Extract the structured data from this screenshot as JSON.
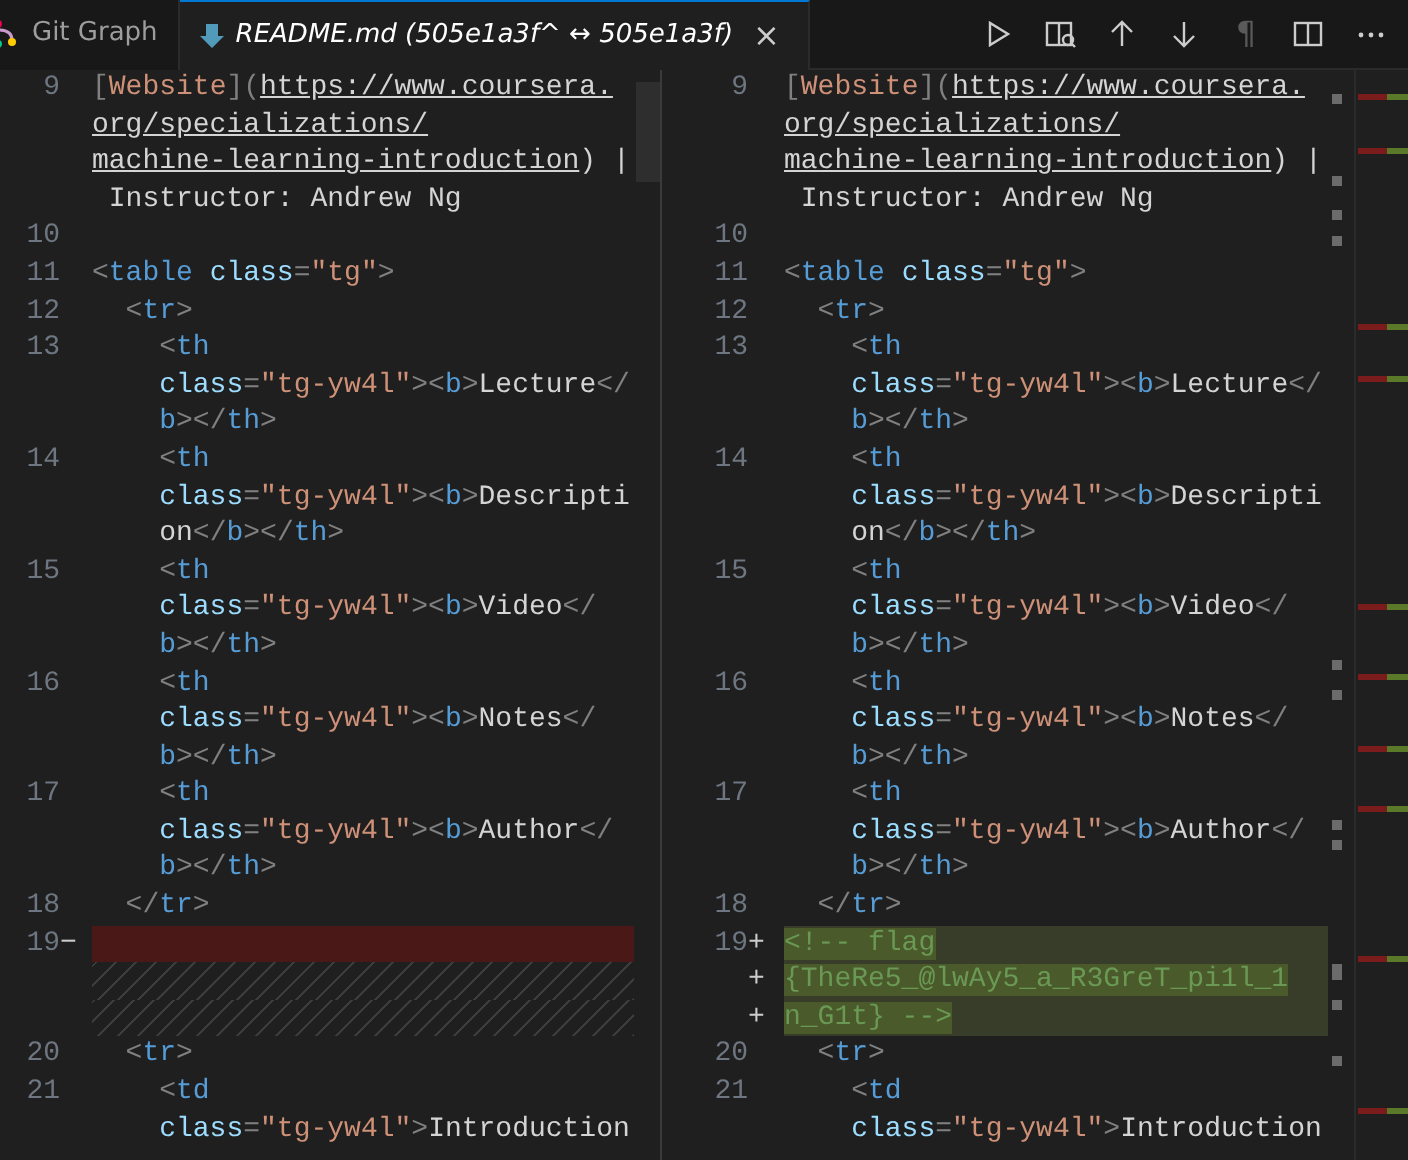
{
  "tabs": [
    {
      "label": "Git Graph",
      "selected": false,
      "preview": false,
      "kind": "git-graph"
    },
    {
      "label": "README.md (505e1a3f^ ↔ 505e1a3f)",
      "selected": true,
      "preview": true,
      "kind": "markdown",
      "close": "×"
    }
  ],
  "toolbar": [
    {
      "kind": "run",
      "disabled": false
    },
    {
      "kind": "preview",
      "disabled": false
    },
    {
      "kind": "up",
      "disabled": false
    },
    {
      "kind": "down",
      "disabled": false
    },
    {
      "kind": "pilcrow",
      "label": "¶",
      "disabled": true
    },
    {
      "kind": "split",
      "disabled": false
    },
    {
      "kind": "more",
      "disabled": false
    }
  ],
  "panes": [
    {
      "lines": [
        {
          "number": "9",
          "kind": "normal",
          "rows": [
            {
              "segments": [
                {
                  "kind": "punct",
                  "text": "["
                },
                {
                  "kind": "link",
                  "text": "Website"
                },
                {
                  "kind": "punct",
                  "text": "]("
                },
                {
                  "kind": "url",
                  "text": "https://www.coursera."
                }
              ]
            },
            {
              "segments": [
                {
                  "kind": "url",
                  "text": "org/specializations/"
                }
              ]
            },
            {
              "segments": [
                {
                  "kind": "url",
                  "text": "machine-learning-introduction"
                },
                {
                  "kind": "text",
                  "text": ") |"
                }
              ]
            },
            {
              "segments": [
                {
                  "kind": "text",
                  "text": " Instructor: Andrew Ng"
                }
              ]
            }
          ]
        },
        {
          "number": "10",
          "kind": "normal"
        },
        {
          "number": "11",
          "kind": "normal",
          "rows": [
            {
              "segments": [
                {
                  "kind": "punct",
                  "text": "<"
                },
                {
                  "kind": "tag",
                  "text": "table"
                },
                {
                  "kind": "attr",
                  "text": " class"
                },
                {
                  "kind": "punct",
                  "text": "="
                },
                {
                  "kind": "string",
                  "text": "\"tg\""
                },
                {
                  "kind": "punct",
                  "text": ">"
                }
              ]
            }
          ]
        },
        {
          "number": "12",
          "kind": "normal",
          "rows": [
            {
              "segments": [
                {
                  "kind": "punct",
                  "text": "  <"
                },
                {
                  "kind": "tag",
                  "text": "tr"
                },
                {
                  "kind": "punct",
                  "text": ">"
                }
              ]
            }
          ]
        },
        {
          "number": "13",
          "kind": "normal",
          "rows": [
            {
              "segments": [
                {
                  "kind": "punct",
                  "text": "    <"
                },
                {
                  "kind": "tag",
                  "text": "th"
                }
              ]
            },
            {
              "segments": [
                {
                  "kind": "attr",
                  "text": "    class"
                },
                {
                  "kind": "punct",
                  "text": "="
                },
                {
                  "kind": "string",
                  "text": "\"tg-yw4l\""
                },
                {
                  "kind": "punct",
                  "text": "><"
                },
                {
                  "kind": "tag",
                  "text": "b"
                },
                {
                  "kind": "punct",
                  "text": ">"
                },
                {
                  "kind": "text",
                  "text": "Lecture"
                },
                {
                  "kind": "punct",
                  "text": "</"
                }
              ]
            },
            {
              "segments": [
                {
                  "kind": "tag",
                  "text": "    b"
                },
                {
                  "kind": "punct",
                  "text": "></"
                },
                {
                  "kind": "tag",
                  "text": "th"
                },
                {
                  "kind": "punct",
                  "text": ">"
                }
              ]
            }
          ]
        },
        {
          "number": "14",
          "kind": "normal",
          "rows": [
            {
              "segments": [
                {
                  "kind": "punct",
                  "text": "    <"
                },
                {
                  "kind": "tag",
                  "text": "th"
                }
              ]
            },
            {
              "segments": [
                {
                  "kind": "attr",
                  "text": "    class"
                },
                {
                  "kind": "punct",
                  "text": "="
                },
                {
                  "kind": "string",
                  "text": "\"tg-yw4l\""
                },
                {
                  "kind": "punct",
                  "text": "><"
                },
                {
                  "kind": "tag",
                  "text": "b"
                },
                {
                  "kind": "punct",
                  "text": ">"
                },
                {
                  "kind": "text",
                  "text": "Descripti"
                }
              ]
            },
            {
              "segments": [
                {
                  "kind": "text",
                  "text": "    on"
                },
                {
                  "kind": "punct",
                  "text": "</"
                },
                {
                  "kind": "tag",
                  "text": "b"
                },
                {
                  "kind": "punct",
                  "text": "></"
                },
                {
                  "kind": "tag",
                  "text": "th"
                },
                {
                  "kind": "punct",
                  "text": ">"
                }
              ]
            }
          ]
        },
        {
          "number": "15",
          "kind": "normal",
          "rows": [
            {
              "segments": [
                {
                  "kind": "punct",
                  "text": "    <"
                },
                {
                  "kind": "tag",
                  "text": "th"
                }
              ]
            },
            {
              "segments": [
                {
                  "kind": "attr",
                  "text": "    class"
                },
                {
                  "kind": "punct",
                  "text": "="
                },
                {
                  "kind": "string",
                  "text": "\"tg-yw4l\""
                },
                {
                  "kind": "punct",
                  "text": "><"
                },
                {
                  "kind": "tag",
                  "text": "b"
                },
                {
                  "kind": "punct",
                  "text": ">"
                },
                {
                  "kind": "text",
                  "text": "Video"
                },
                {
                  "kind": "punct",
                  "text": "</"
                }
              ]
            },
            {
              "segments": [
                {
                  "kind": "tag",
                  "text": "    b"
                },
                {
                  "kind": "punct",
                  "text": "></"
                },
                {
                  "kind": "tag",
                  "text": "th"
                },
                {
                  "kind": "punct",
                  "text": ">"
                }
              ]
            }
          ]
        },
        {
          "number": "16",
          "kind": "normal",
          "rows": [
            {
              "segments": [
                {
                  "kind": "punct",
                  "text": "    <"
                },
                {
                  "kind": "tag",
                  "text": "th"
                }
              ]
            },
            {
              "segments": [
                {
                  "kind": "attr",
                  "text": "    class"
                },
                {
                  "kind": "punct",
                  "text": "="
                },
                {
                  "kind": "string",
                  "text": "\"tg-yw4l\""
                },
                {
                  "kind": "punct",
                  "text": "><"
                },
                {
                  "kind": "tag",
                  "text": "b"
                },
                {
                  "kind": "punct",
                  "text": ">"
                },
                {
                  "kind": "text",
                  "text": "Notes"
                },
                {
                  "kind": "punct",
                  "text": "</"
                }
              ]
            },
            {
              "segments": [
                {
                  "kind": "tag",
                  "text": "    b"
                },
                {
                  "kind": "punct",
                  "text": "></"
                },
                {
                  "kind": "tag",
                  "text": "th"
                },
                {
                  "kind": "punct",
                  "text": ">"
                }
              ]
            }
          ]
        },
        {
          "number": "17",
          "kind": "normal",
          "rows": [
            {
              "segments": [
                {
                  "kind": "punct",
                  "text": "    <"
                },
                {
                  "kind": "tag",
                  "text": "th"
                }
              ]
            },
            {
              "segments": [
                {
                  "kind": "attr",
                  "text": "    class"
                },
                {
                  "kind": "punct",
                  "text": "="
                },
                {
                  "kind": "string",
                  "text": "\"tg-yw4l\""
                },
                {
                  "kind": "punct",
                  "text": "><"
                },
                {
                  "kind": "tag",
                  "text": "b"
                },
                {
                  "kind": "punct",
                  "text": ">"
                },
                {
                  "kind": "text",
                  "text": "Author"
                },
                {
                  "kind": "punct",
                  "text": "</"
                }
              ]
            },
            {
              "segments": [
                {
                  "kind": "tag",
                  "text": "    b"
                },
                {
                  "kind": "punct",
                  "text": "></"
                },
                {
                  "kind": "tag",
                  "text": "th"
                },
                {
                  "kind": "punct",
                  "text": ">"
                }
              ]
            }
          ]
        },
        {
          "number": "18",
          "kind": "normal",
          "rows": [
            {
              "segments": [
                {
                  "kind": "punct",
                  "text": "  </"
                },
                {
                  "kind": "tag",
                  "text": "tr"
                },
                {
                  "kind": "punct",
                  "text": ">"
                }
              ]
            }
          ]
        },
        {
          "number": "19",
          "kind": "removed",
          "rows": [
            {
              "marker": "−"
            }
          ]
        },
        {
          "kind": "filler"
        },
        {
          "kind": "filler"
        },
        {
          "number": "20",
          "kind": "normal",
          "rows": [
            {
              "segments": [
                {
                  "kind": "punct",
                  "text": "  <"
                },
                {
                  "kind": "tag",
                  "text": "tr"
                },
                {
                  "kind": "punct",
                  "text": ">"
                }
              ]
            }
          ]
        },
        {
          "number": "21",
          "kind": "normal",
          "rows": [
            {
              "segments": [
                {
                  "kind": "punct",
                  "text": "    <"
                },
                {
                  "kind": "tag",
                  "text": "td"
                }
              ]
            },
            {
              "segments": [
                {
                  "kind": "attr",
                  "text": "    class"
                },
                {
                  "kind": "punct",
                  "text": "="
                },
                {
                  "kind": "string",
                  "text": "\"tg-yw4l\""
                },
                {
                  "kind": "punct",
                  "text": ">"
                },
                {
                  "kind": "text",
                  "text": "Introduction"
                }
              ]
            }
          ]
        }
      ]
    },
    {
      "lines": [
        {
          "number": "9",
          "kind": "normal",
          "rows": [
            {
              "segments": [
                {
                  "kind": "punct",
                  "text": "["
                },
                {
                  "kind": "link",
                  "text": "Website"
                },
                {
                  "kind": "punct",
                  "text": "]("
                },
                {
                  "kind": "url",
                  "text": "https://www.coursera."
                }
              ]
            },
            {
              "segments": [
                {
                  "kind": "url",
                  "text": "org/specializations/"
                }
              ]
            },
            {
              "segments": [
                {
                  "kind": "url",
                  "text": "machine-learning-introduction"
                },
                {
                  "kind": "text",
                  "text": ") |"
                }
              ]
            },
            {
              "segments": [
                {
                  "kind": "text",
                  "text": " Instructor: Andrew Ng"
                }
              ]
            }
          ]
        },
        {
          "number": "10",
          "kind": "normal"
        },
        {
          "number": "11",
          "kind": "normal",
          "rows": [
            {
              "segments": [
                {
                  "kind": "punct",
                  "text": "<"
                },
                {
                  "kind": "tag",
                  "text": "table"
                },
                {
                  "kind": "attr",
                  "text": " class"
                },
                {
                  "kind": "punct",
                  "text": "="
                },
                {
                  "kind": "string",
                  "text": "\"tg\""
                },
                {
                  "kind": "punct",
                  "text": ">"
                }
              ]
            }
          ]
        },
        {
          "number": "12",
          "kind": "normal",
          "rows": [
            {
              "segments": [
                {
                  "kind": "punct",
                  "text": "  <"
                },
                {
                  "kind": "tag",
                  "text": "tr"
                },
                {
                  "kind": "punct",
                  "text": ">"
                }
              ]
            }
          ]
        },
        {
          "number": "13",
          "kind": "normal",
          "rows": [
            {
              "segments": [
                {
                  "kind": "punct",
                  "text": "    <"
                },
                {
                  "kind": "tag",
                  "text": "th"
                }
              ]
            },
            {
              "segments": [
                {
                  "kind": "attr",
                  "text": "    class"
                },
                {
                  "kind": "punct",
                  "text": "="
                },
                {
                  "kind": "string",
                  "text": "\"tg-yw4l\""
                },
                {
                  "kind": "punct",
                  "text": "><"
                },
                {
                  "kind": "tag",
                  "text": "b"
                },
                {
                  "kind": "punct",
                  "text": ">"
                },
                {
                  "kind": "text",
                  "text": "Lecture"
                },
                {
                  "kind": "punct",
                  "text": "</"
                }
              ]
            },
            {
              "segments": [
                {
                  "kind": "tag",
                  "text": "    b"
                },
                {
                  "kind": "punct",
                  "text": "></"
                },
                {
                  "kind": "tag",
                  "text": "th"
                },
                {
                  "kind": "punct",
                  "text": ">"
                }
              ]
            }
          ]
        },
        {
          "number": "14",
          "kind": "normal",
          "rows": [
            {
              "segments": [
                {
                  "kind": "punct",
                  "text": "    <"
                },
                {
                  "kind": "tag",
                  "text": "th"
                }
              ]
            },
            {
              "segments": [
                {
                  "kind": "attr",
                  "text": "    class"
                },
                {
                  "kind": "punct",
                  "text": "="
                },
                {
                  "kind": "string",
                  "text": "\"tg-yw4l\""
                },
                {
                  "kind": "punct",
                  "text": "><"
                },
                {
                  "kind": "tag",
                  "text": "b"
                },
                {
                  "kind": "punct",
                  "text": ">"
                },
                {
                  "kind": "text",
                  "text": "Descripti"
                }
              ]
            },
            {
              "segments": [
                {
                  "kind": "text",
                  "text": "    on"
                },
                {
                  "kind": "punct",
                  "text": "</"
                },
                {
                  "kind": "tag",
                  "text": "b"
                },
                {
                  "kind": "punct",
                  "text": "></"
                },
                {
                  "kind": "tag",
                  "text": "th"
                },
                {
                  "kind": "punct",
                  "text": ">"
                }
              ]
            }
          ]
        },
        {
          "number": "15",
          "kind": "normal",
          "rows": [
            {
              "segments": [
                {
                  "kind": "punct",
                  "text": "    <"
                },
                {
                  "kind": "tag",
                  "text": "th"
                }
              ]
            },
            {
              "segments": [
                {
                  "kind": "attr",
                  "text": "    class"
                },
                {
                  "kind": "punct",
                  "text": "="
                },
                {
                  "kind": "string",
                  "text": "\"tg-yw4l\""
                },
                {
                  "kind": "punct",
                  "text": "><"
                },
                {
                  "kind": "tag",
                  "text": "b"
                },
                {
                  "kind": "punct",
                  "text": ">"
                },
                {
                  "kind": "text",
                  "text": "Video"
                },
                {
                  "kind": "punct",
                  "text": "</"
                }
              ]
            },
            {
              "segments": [
                {
                  "kind": "tag",
                  "text": "    b"
                },
                {
                  "kind": "punct",
                  "text": "></"
                },
                {
                  "kind": "tag",
                  "text": "th"
                },
                {
                  "kind": "punct",
                  "text": ">"
                }
              ]
            }
          ]
        },
        {
          "number": "16",
          "kind": "normal",
          "rows": [
            {
              "segments": [
                {
                  "kind": "punct",
                  "text": "    <"
                },
                {
                  "kind": "tag",
                  "text": "th"
                }
              ]
            },
            {
              "segments": [
                {
                  "kind": "attr",
                  "text": "    class"
                },
                {
                  "kind": "punct",
                  "text": "="
                },
                {
                  "kind": "string",
                  "text": "\"tg-yw4l\""
                },
                {
                  "kind": "punct",
                  "text": "><"
                },
                {
                  "kind": "tag",
                  "text": "b"
                },
                {
                  "kind": "punct",
                  "text": ">"
                },
                {
                  "kind": "text",
                  "text": "Notes"
                },
                {
                  "kind": "punct",
                  "text": "</"
                }
              ]
            },
            {
              "segments": [
                {
                  "kind": "tag",
                  "text": "    b"
                },
                {
                  "kind": "punct",
                  "text": "></"
                },
                {
                  "kind": "tag",
                  "text": "th"
                },
                {
                  "kind": "punct",
                  "text": ">"
                }
              ]
            }
          ]
        },
        {
          "number": "17",
          "kind": "normal",
          "rows": [
            {
              "segments": [
                {
                  "kind": "punct",
                  "text": "    <"
                },
                {
                  "kind": "tag",
                  "text": "th"
                }
              ]
            },
            {
              "segments": [
                {
                  "kind": "attr",
                  "text": "    class"
                },
                {
                  "kind": "punct",
                  "text": "="
                },
                {
                  "kind": "string",
                  "text": "\"tg-yw4l\""
                },
                {
                  "kind": "punct",
                  "text": "><"
                },
                {
                  "kind": "tag",
                  "text": "b"
                },
                {
                  "kind": "punct",
                  "text": ">"
                },
                {
                  "kind": "text",
                  "text": "Author"
                },
                {
                  "kind": "punct",
                  "text": "</"
                }
              ]
            },
            {
              "segments": [
                {
                  "kind": "tag",
                  "text": "    b"
                },
                {
                  "kind": "punct",
                  "text": "></"
                },
                {
                  "kind": "tag",
                  "text": "th"
                },
                {
                  "kind": "punct",
                  "text": ">"
                }
              ]
            }
          ]
        },
        {
          "number": "18",
          "kind": "normal",
          "rows": [
            {
              "segments": [
                {
                  "kind": "punct",
                  "text": "  </"
                },
                {
                  "kind": "tag",
                  "text": "tr"
                },
                {
                  "kind": "punct",
                  "text": ">"
                }
              ]
            }
          ]
        },
        {
          "number": "19",
          "kind": "added",
          "rows": [
            {
              "marker": "+",
              "segments": [
                {
                  "kind": "comment",
                  "text": "<!-- flag"
                }
              ]
            },
            {
              "marker": "+",
              "segments": [
                {
                  "kind": "comment",
                  "text": "{TheRe5_@lwAy5_a_R3GreT_pi1l_1"
                }
              ]
            },
            {
              "marker": "+",
              "segments": [
                {
                  "kind": "comment",
                  "text": "n_G1t} -->"
                }
              ]
            }
          ]
        },
        {
          "number": "20",
          "kind": "normal",
          "rows": [
            {
              "segments": [
                {
                  "kind": "punct",
                  "text": "  <"
                },
                {
                  "kind": "tag",
                  "text": "tr"
                },
                {
                  "kind": "punct",
                  "text": ">"
                }
              ]
            }
          ]
        },
        {
          "number": "21",
          "kind": "normal",
          "rows": [
            {
              "segments": [
                {
                  "kind": "punct",
                  "text": "    <"
                },
                {
                  "kind": "tag",
                  "text": "td"
                }
              ]
            },
            {
              "segments": [
                {
                  "kind": "attr",
                  "text": "    class"
                },
                {
                  "kind": "punct",
                  "text": "="
                },
                {
                  "kind": "string",
                  "text": "\"tg-yw4l\""
                },
                {
                  "kind": "punct",
                  "text": ">"
                },
                {
                  "kind": "text",
                  "text": "Introduction"
                }
              ]
            }
          ]
        }
      ]
    }
  ]
}
